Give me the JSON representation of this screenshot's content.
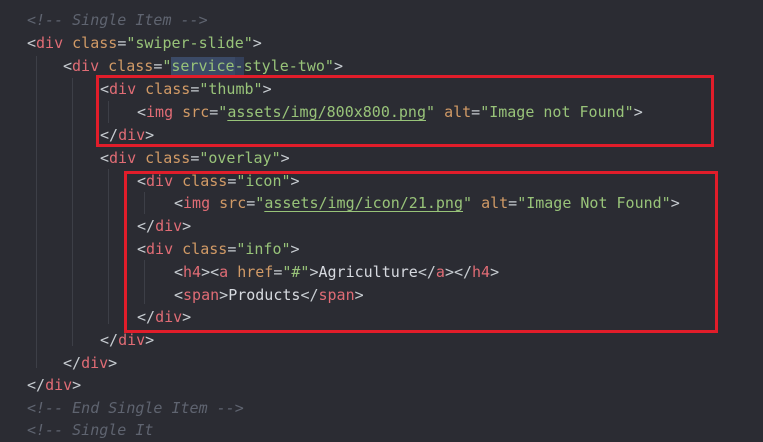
{
  "colors": {
    "background": "#2b2c33",
    "tag": "#e06c75",
    "attribute": "#d19a66",
    "string": "#98c379",
    "comment": "#5f6470",
    "highlight_box": "#e11d2a"
  },
  "code": {
    "l1": "<!-- Single Item -->",
    "l2_tag": "div",
    "l2_attr": "class",
    "l2_val": "\"swiper-slide\"",
    "l3_tag": "div",
    "l3_attr": "class",
    "l3_val_open": "\"",
    "l3_val_sel": "service",
    "l3_val_hl2": "-",
    "l3_val_rest": "style-two\"",
    "l4_tag": "div",
    "l4_attr": "class",
    "l4_val": "\"thumb\"",
    "l5_tag": "img",
    "l5_attr1": "src",
    "l5_q1": "\"",
    "l5_path": "assets/img/800x800.png",
    "l5_q2": "\"",
    "l5_attr2": "alt",
    "l5_val2": "\"Image not Found\"",
    "l6_tag": "div",
    "l7_tag": "div",
    "l7_attr": "class",
    "l7_val": "\"overlay\"",
    "l8_tag": "div",
    "l8_attr": "class",
    "l8_val": "\"icon\"",
    "l9_tag": "img",
    "l9_attr1": "src",
    "l9_q1": "\"",
    "l9_path": "assets/img/icon/21.png",
    "l9_q2": "\"",
    "l9_attr2": "alt",
    "l9_val2": "\"Image Not Found\"",
    "l10_tag": "div",
    "l11_tag": "div",
    "l11_attr": "class",
    "l11_val": "\"info\"",
    "l12_h4": "h4",
    "l12_a": "a",
    "l12_attr": "href",
    "l12_val": "\"#\"",
    "l12_text": "Agriculture",
    "l12_a_close": "a",
    "l12_h4_close": "h4",
    "l13_tag": "span",
    "l13_text": "Products",
    "l13_close": "span",
    "l14_tag": "div",
    "l15_tag": "div",
    "l16_tag": "div",
    "l17_tag": "div",
    "l18": "<!-- End Single Item -->",
    "l19": "<!-- Single It"
  }
}
